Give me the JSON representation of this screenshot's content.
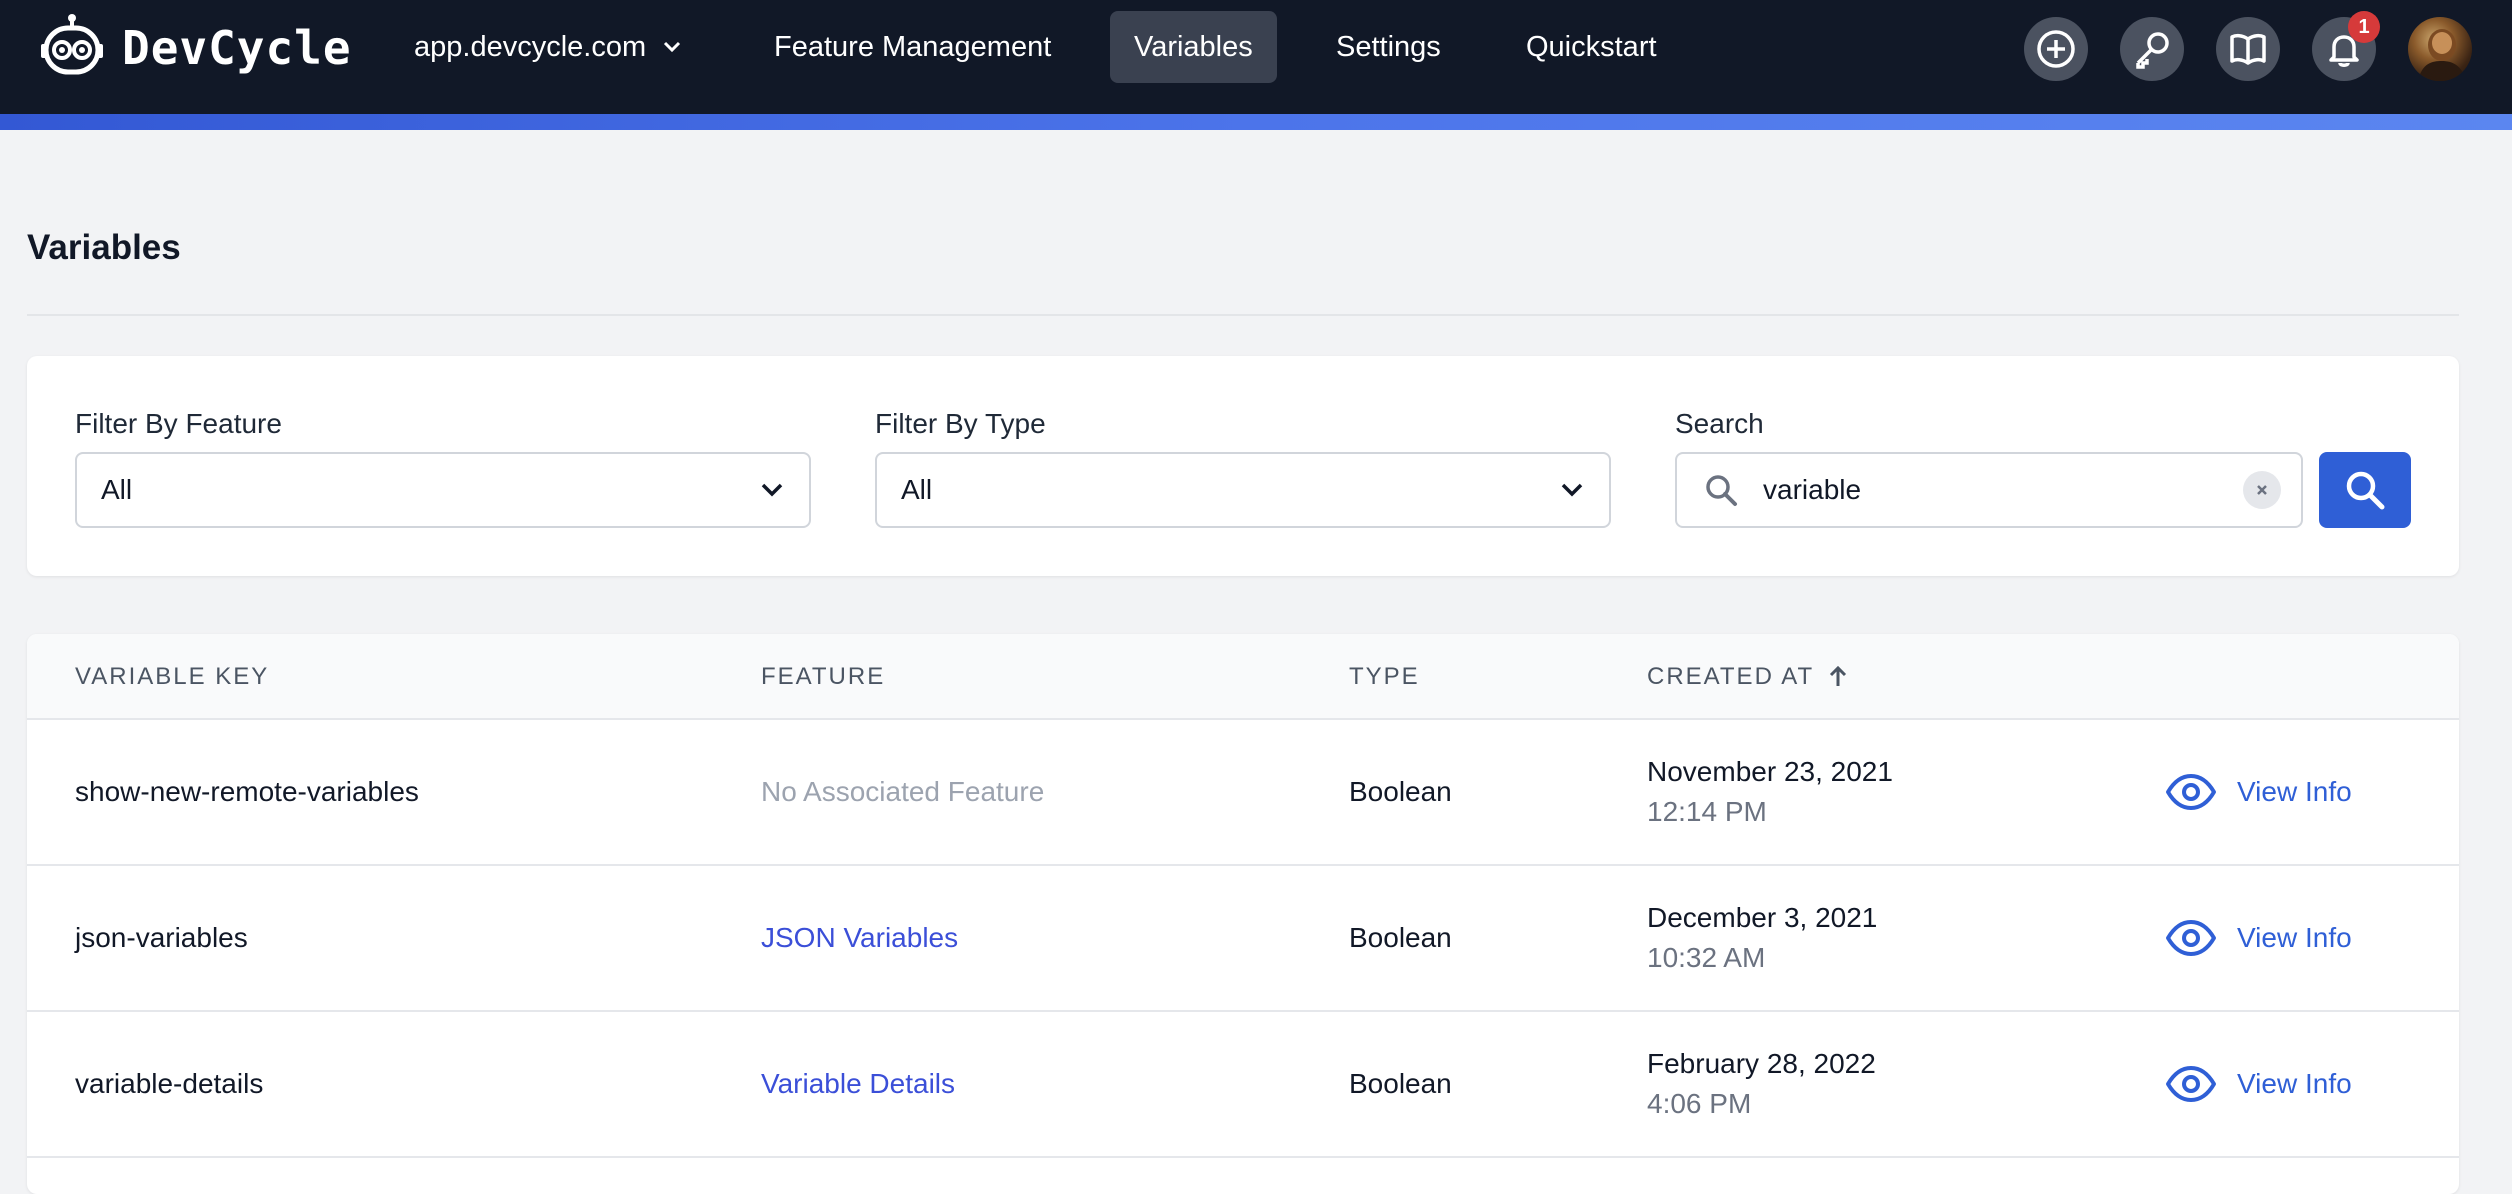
{
  "brand": {
    "name": "DevCycle",
    "accent": "#2f5fd6",
    "nav_bg": "#111827"
  },
  "nav": {
    "org": "app.devcycle.com",
    "items": [
      {
        "label": "Feature Management"
      },
      {
        "label": "Variables",
        "active": true
      },
      {
        "label": "Settings"
      },
      {
        "label": "Quickstart"
      }
    ],
    "icons": [
      "plus-circle-icon",
      "key-icon",
      "book-icon",
      "bell-icon"
    ],
    "notification_count": "1"
  },
  "page": {
    "title": "Variables"
  },
  "filters": {
    "feature": {
      "label": "Filter By Feature",
      "value": "All"
    },
    "type": {
      "label": "Filter By Type",
      "value": "All"
    },
    "search": {
      "label": "Search",
      "value": "variable"
    }
  },
  "table": {
    "columns": [
      "VARIABLE KEY",
      "FEATURE",
      "TYPE",
      "CREATED AT"
    ],
    "sort_indicator": "ascending",
    "action_label": "View Info",
    "rows": [
      {
        "key": "show-new-remote-variables",
        "feature": "No Associated Feature",
        "feature_linked": false,
        "type": "Boolean",
        "date": "November 23, 2021",
        "time": "12:14 PM"
      },
      {
        "key": "json-variables",
        "feature": "JSON Variables",
        "feature_linked": true,
        "type": "Boolean",
        "date": "December 3, 2021",
        "time": "10:32 AM"
      },
      {
        "key": "variable-details",
        "feature": "Variable Details",
        "feature_linked": true,
        "type": "Boolean",
        "date": "February 28, 2022",
        "time": "4:06 PM"
      }
    ]
  }
}
